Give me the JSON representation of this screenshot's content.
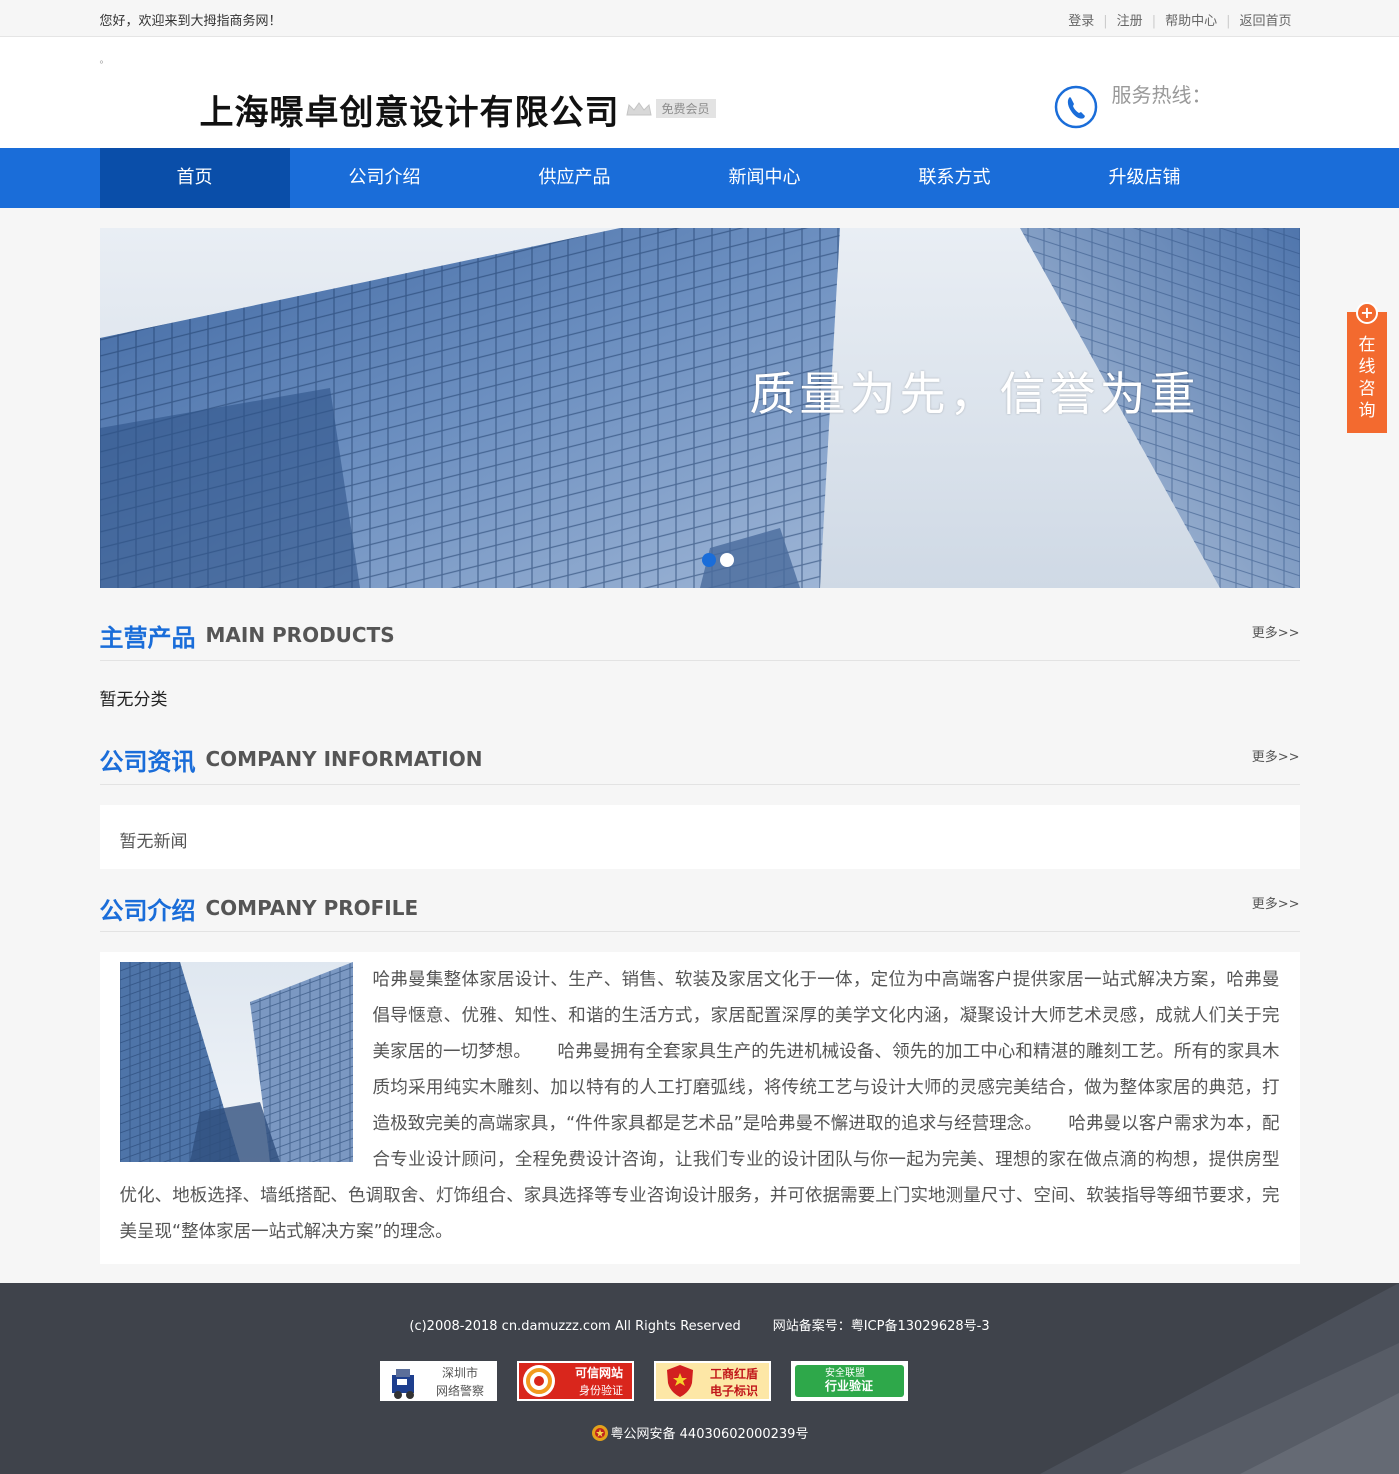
{
  "topbar": {
    "welcome": "您好，欢迎来到大拇指商务网！",
    "links": [
      "登录",
      "注册",
      "帮助中心",
      "返回首页"
    ]
  },
  "header": {
    "dot": "。",
    "company_name": "上海暻卓创意设计有限公司",
    "member_badge": "免费会员",
    "hotline_label": "服务热线："
  },
  "nav": {
    "items": [
      "首页",
      "公司介绍",
      "供应产品",
      "新闻中心",
      "联系方式",
      "升级店铺"
    ],
    "active_index": 0
  },
  "banner": {
    "slogan": "质量为先，信誉为重",
    "slide_count": 2,
    "active_slide": 0
  },
  "sections": {
    "products": {
      "cn": "主营产品",
      "en": "MAIN PRODUCTS",
      "more": "更多>>",
      "empty": "暂无分类"
    },
    "news": {
      "cn": "公司资讯",
      "en": "COMPANY INFORMATION",
      "more": "更多>>",
      "empty": "暂无新闻"
    },
    "profile": {
      "cn": "公司介绍",
      "en": "COMPANY PROFILE",
      "more": "更多>>",
      "text": "哈弗曼集整体家居设计、生产、销售、软装及家居文化于一体，定位为中高端客户提供家居一站式解决方案，哈弗曼倡导惬意、优雅、知性、和谐的生活方式，家居配置深厚的美学文化内涵，凝聚设计大师艺术灵感，成就人们关于完美家居的一切梦想。　　哈弗曼拥有全套家具生产的先进机械设备、领先的加工中心和精湛的雕刻工艺。所有的家具木质均采用纯实木雕刻、加以特有的人工打磨弧线，将传统工艺与设计大师的灵感完美结合，做为整体家居的典范，打造极致完美的高端家具，“件件家具都是艺术品”是哈弗曼不懈进取的追求与经营理念。　　哈弗曼以客户需求为本，配合专业设计顾问，全程免费设计咨询，让我们专业的设计团队与你一起为完美、理想的家在做点滴的构想，提供房型优化、地板选择、墙纸搭配、色调取舍、灯饰组合、家具选择等专业咨询设计服务，并可依据需要上门实地测量尺寸、空间、软装指导等细节要求，完美呈现“整体家居一站式解决方案”的理念。"
    }
  },
  "footer": {
    "copyright": "(c)2008-2018 cn.damuzzz.com All Rights Reserved",
    "icp": "网站备案号：粤ICP备13029628号-3",
    "badges": [
      {
        "line1": "深圳市",
        "line2": "网络警察"
      },
      {
        "line1": "可信网站",
        "line2": "身份验证"
      },
      {
        "line1": "工商红盾",
        "line2": "电子标识"
      },
      {
        "line1": "安全联盟",
        "line2": "行业验证"
      }
    ],
    "police_record": "粤公网安备 44030602000239号"
  },
  "consult": {
    "label": "在线咨询",
    "plus": "+"
  },
  "colors": {
    "brand_blue": "#1a6dd9",
    "nav_active": "#0a4ea9",
    "consult_orange": "#f36a2f",
    "footer_bg": "#3f434b"
  }
}
